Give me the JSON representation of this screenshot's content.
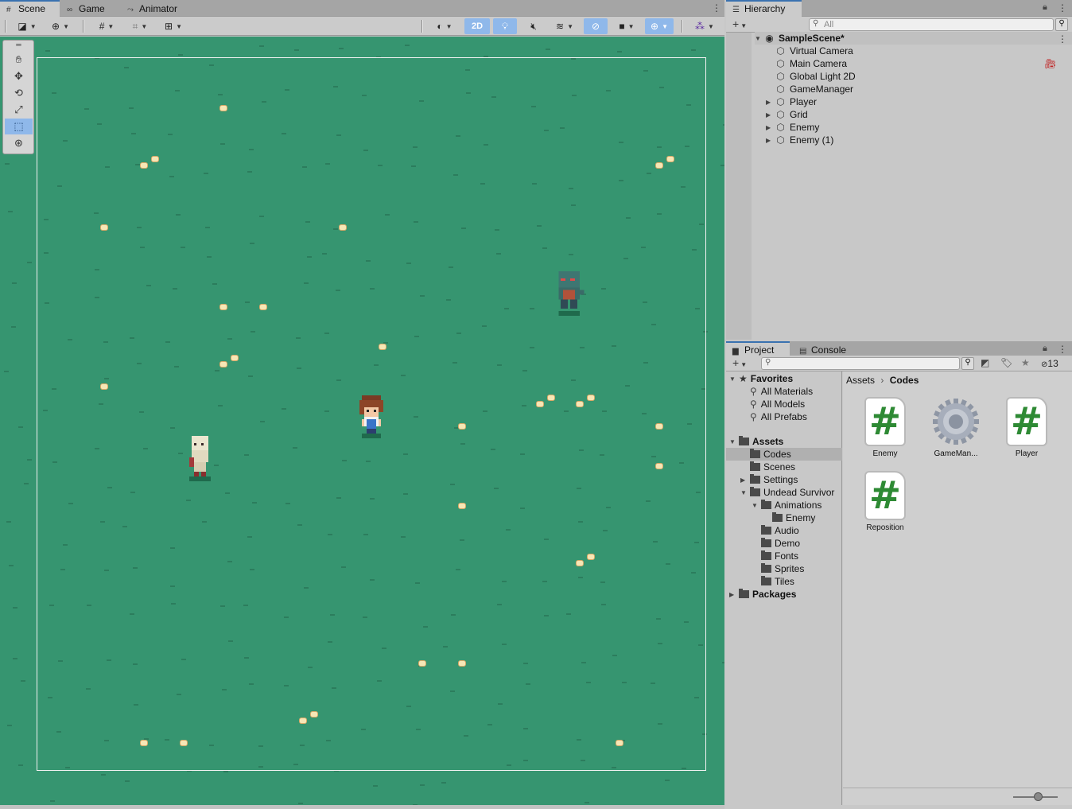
{
  "scene_tabs": [
    {
      "label": "Scene",
      "icon": "grid-icon"
    },
    {
      "label": "Game",
      "icon": "gamepad-icon"
    },
    {
      "label": "Animator",
      "icon": "animator-icon"
    }
  ],
  "scene_toolbar": {
    "mode_2d_label": "2D"
  },
  "hierarchy": {
    "tab_label": "Hierarchy",
    "search_placeholder": "All",
    "scene_name": "SampleScene*",
    "items": [
      {
        "label": "Virtual Camera",
        "expandable": false
      },
      {
        "label": "Main Camera",
        "expandable": false
      },
      {
        "label": "Global Light 2D",
        "expandable": false
      },
      {
        "label": "GameManager",
        "expandable": false
      },
      {
        "label": "Player",
        "expandable": true
      },
      {
        "label": "Grid",
        "expandable": true
      },
      {
        "label": "Enemy",
        "expandable": true
      },
      {
        "label": "Enemy (1)",
        "expandable": true
      }
    ]
  },
  "project": {
    "tabs": [
      {
        "label": "Project",
        "icon": "folder-icon"
      },
      {
        "label": "Console",
        "icon": "console-icon"
      }
    ],
    "hidden_count": "13",
    "favorites_label": "Favorites",
    "favorites": [
      "All Materials",
      "All Models",
      "All Prefabs"
    ],
    "assets_label": "Assets",
    "tree": [
      {
        "label": "Codes",
        "indent": 1,
        "selected": true,
        "arrow": ""
      },
      {
        "label": "Scenes",
        "indent": 1,
        "selected": false,
        "arrow": ""
      },
      {
        "label": "Settings",
        "indent": 1,
        "selected": false,
        "arrow": "right"
      },
      {
        "label": "Undead Survivor",
        "indent": 1,
        "selected": false,
        "arrow": "down"
      },
      {
        "label": "Animations",
        "indent": 2,
        "selected": false,
        "arrow": "down"
      },
      {
        "label": "Enemy",
        "indent": 3,
        "selected": false,
        "arrow": ""
      },
      {
        "label": "Audio",
        "indent": 2,
        "selected": false,
        "arrow": ""
      },
      {
        "label": "Demo",
        "indent": 2,
        "selected": false,
        "arrow": ""
      },
      {
        "label": "Fonts",
        "indent": 2,
        "selected": false,
        "arrow": ""
      },
      {
        "label": "Sprites",
        "indent": 2,
        "selected": false,
        "arrow": ""
      },
      {
        "label": "Tiles",
        "indent": 2,
        "selected": false,
        "arrow": ""
      }
    ],
    "packages_label": "Packages",
    "breadcrumb": {
      "root": "Assets",
      "current": "Codes"
    },
    "assets": [
      {
        "label": "Enemy",
        "type": "script"
      },
      {
        "label": "GameMan...",
        "type": "gear"
      },
      {
        "label": "Player",
        "type": "script"
      },
      {
        "label": "Reposition",
        "type": "script"
      }
    ]
  }
}
